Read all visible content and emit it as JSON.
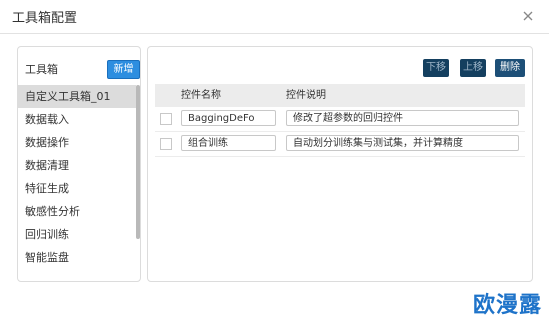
{
  "dialog": {
    "title": "工具箱配置"
  },
  "toolbox": {
    "title": "工具箱",
    "new_label": "新增",
    "items": [
      {
        "label": "自定义工具箱_01"
      },
      {
        "label": "数据载入"
      },
      {
        "label": "数据操作"
      },
      {
        "label": "数据清理"
      },
      {
        "label": "特征生成"
      },
      {
        "label": "敏感性分析"
      },
      {
        "label": "回归训练"
      },
      {
        "label": "智能监盘"
      }
    ],
    "selected_index": 0
  },
  "controls": {
    "down_label": "下移",
    "up_label": "上移",
    "delete_label": "删除",
    "columns": {
      "name": "控件名称",
      "desc": "控件说明"
    },
    "rows": [
      {
        "name": "BaggingDeFo",
        "desc": "修改了超参数的回归控件"
      },
      {
        "name": "组合训练",
        "desc": "自动划分训练集与测试集，并计算精度"
      }
    ]
  },
  "watermark": "欧漫露"
}
